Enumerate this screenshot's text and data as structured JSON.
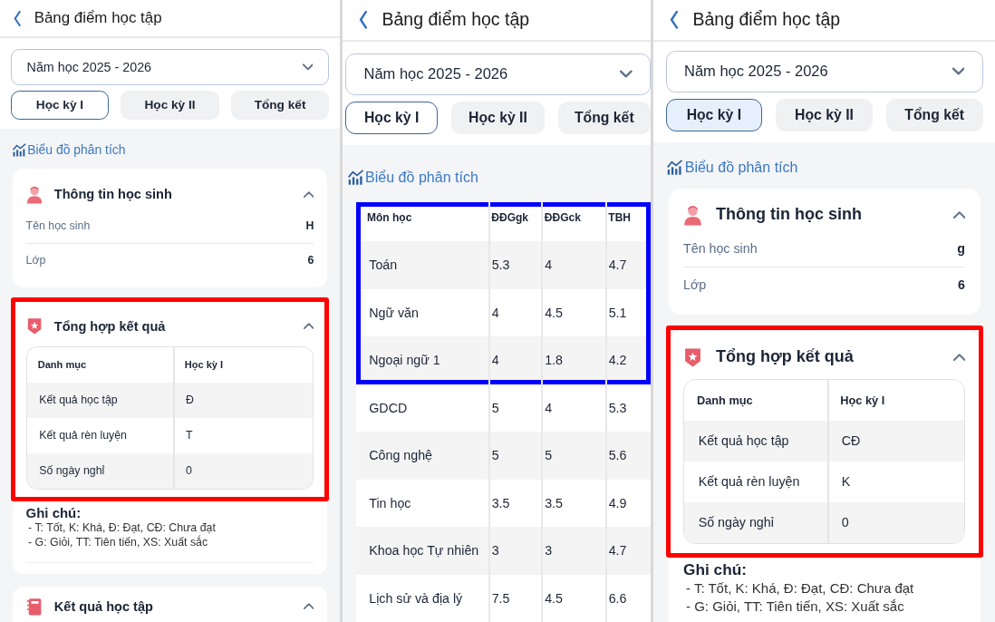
{
  "panels": [
    {
      "kind": "summary",
      "title": "Bảng điểm học tập",
      "year": "Năm học 2025 - 2026",
      "tabs": [
        {
          "label": "Học kỳ I",
          "selected": true
        },
        {
          "label": "Học kỳ II",
          "selected": false
        },
        {
          "label": "Tổng kết",
          "selected": false
        }
      ],
      "chart_link": "Biểu đồ phân tích",
      "student": {
        "title": "Thông tin học sinh",
        "expanded": true,
        "rows": [
          {
            "label": "Tên học sinh",
            "value": "H"
          },
          {
            "label": "Lớp",
            "value": "6"
          }
        ]
      },
      "summary": {
        "title": "Tổng hợp kết quả",
        "expanded": true,
        "highlight": {
          "color": "#ff0000"
        },
        "columns": [
          "Danh mục",
          "Học kỳ I"
        ],
        "rows": [
          [
            "Kết quả học tập",
            "Đ"
          ],
          [
            "Kết quả rèn luyện",
            "T"
          ],
          [
            "Số ngày nghỉ",
            "0"
          ]
        ]
      },
      "notes": {
        "title": "Ghi chú:",
        "lines": [
          "- T: Tốt, K: Khá, Đ: Đạt, CĐ: Chưa đạt",
          "- G: Giỏi, TT: Tiên tiến, XS: Xuất sắc"
        ]
      },
      "next_card": {
        "title": "Kết quả học tập",
        "expanded": true
      }
    },
    {
      "kind": "scores",
      "title": "Bảng điểm học tập",
      "year": "Năm học 2025 - 2026",
      "tabs": [
        {
          "label": "Học kỳ I",
          "selected": true
        },
        {
          "label": "Học kỳ II",
          "selected": false
        },
        {
          "label": "Tổng kết",
          "selected": false
        }
      ],
      "chart_link": "Biểu đồ phân tích",
      "table": {
        "highlight": {
          "color": "#0000ff"
        },
        "columns": [
          "Môn học",
          "ĐĐGgk",
          "ĐĐGck",
          "TBH"
        ],
        "rows": [
          {
            "cells": [
              "Toán",
              "5.3",
              "4",
              "4.7"
            ],
            "highlighted": true
          },
          {
            "cells": [
              "Ngữ văn",
              "4",
              "4.5",
              "5.1"
            ],
            "highlighted": true
          },
          {
            "cells": [
              "Ngoại ngữ 1",
              "4",
              "1.8",
              "4.2"
            ],
            "highlighted": true
          },
          {
            "cells": [
              "GDCD",
              "5",
              "4",
              "5.3"
            ],
            "highlighted": false
          },
          {
            "cells": [
              "Công nghệ",
              "5",
              "5",
              "5.6"
            ],
            "highlighted": false
          },
          {
            "cells": [
              "Tin học",
              "3.5",
              "3.5",
              "4.9"
            ],
            "highlighted": false
          },
          {
            "cells": [
              "Khoa học Tự nhiên",
              "3",
              "3",
              "4.7"
            ],
            "highlighted": false
          },
          {
            "cells": [
              "Lịch sử và địa lý",
              "7.5",
              "4.5",
              "6.6"
            ],
            "highlighted": false
          }
        ]
      }
    },
    {
      "kind": "summary",
      "title": "Bảng điểm học tập",
      "year": "Năm học 2025 - 2026",
      "tabs": [
        {
          "label": "Học kỳ I",
          "selected": true
        },
        {
          "label": "Học kỳ II",
          "selected": false
        },
        {
          "label": "Tổng kết",
          "selected": false
        }
      ],
      "chart_link": "Biểu đồ phân tích",
      "student": {
        "title": "Thông tin học sinh",
        "expanded": true,
        "rows": [
          {
            "label": "Tên học sinh",
            "value": "g"
          },
          {
            "label": "Lớp",
            "value": "6"
          }
        ]
      },
      "summary": {
        "title": "Tổng hợp kết quả",
        "expanded": true,
        "highlight": {
          "color": "#ff0000"
        },
        "columns": [
          "Danh mục",
          "Học kỳ I"
        ],
        "rows": [
          [
            "Kết quả học tập",
            "CĐ"
          ],
          [
            "Kết quả rèn luyện",
            "K"
          ],
          [
            "Số ngày nghỉ",
            "0"
          ]
        ]
      },
      "notes": {
        "title": "Ghi chú:",
        "lines": [
          "- T: Tốt, K: Khá, Đ: Đạt, CĐ: Chưa đạt",
          "- G: Giỏi, TT: Tiên tiến, XS: Xuất sắc"
        ]
      }
    }
  ]
}
